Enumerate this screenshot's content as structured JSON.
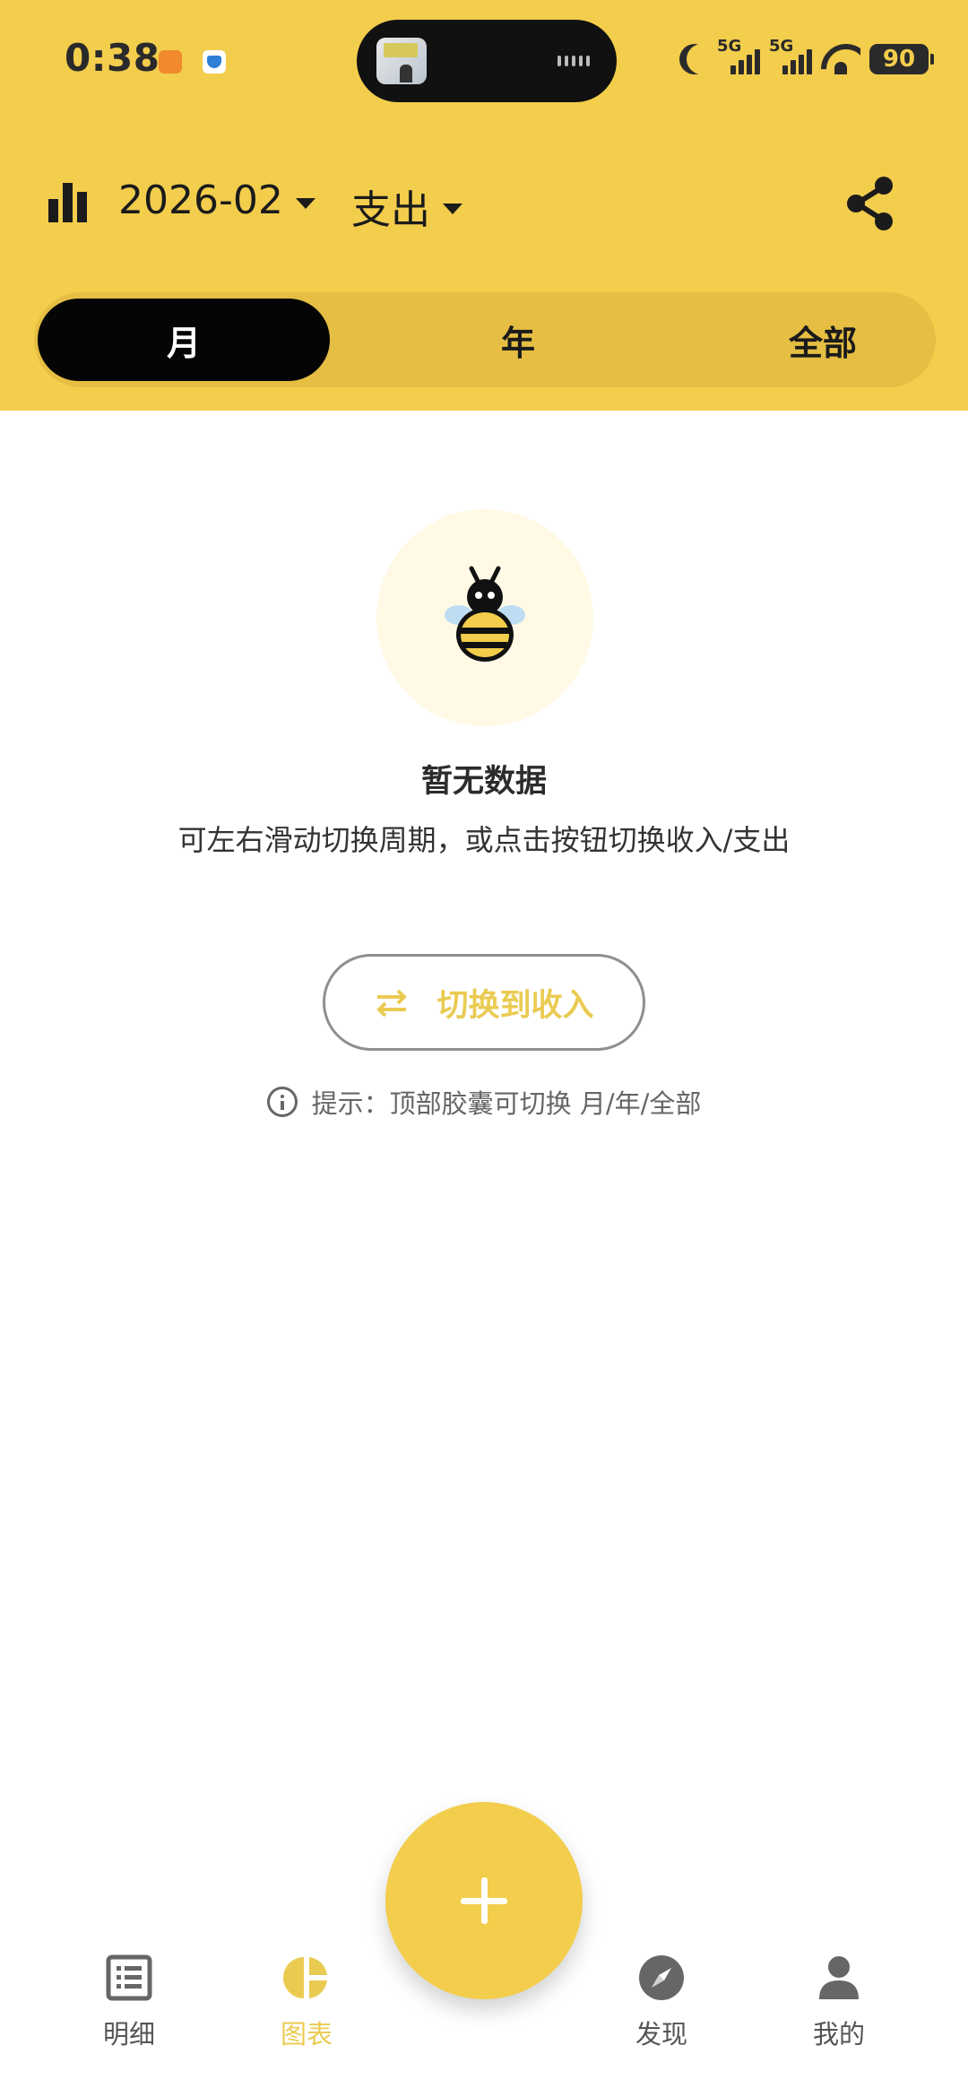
{
  "status_bar": {
    "time": "0:38",
    "network_1": "5G",
    "network_2": "5G",
    "battery": "90"
  },
  "toolbar": {
    "period": "2026-02",
    "type": "支出"
  },
  "segment_tabs": [
    {
      "label": "月",
      "active": true
    },
    {
      "label": "年",
      "active": false
    },
    {
      "label": "全部",
      "active": false
    }
  ],
  "empty_state": {
    "title": "暂无数据",
    "description": "可左右滑动切换周期，或点击按钮切换收入/支出",
    "switch_button": "切换到收入",
    "hint": "提示：顶部胶囊可切换 月/年/全部"
  },
  "bottom_nav": [
    {
      "label": "明细",
      "icon": "list-icon",
      "active": false
    },
    {
      "label": "图表",
      "icon": "pie-chart-icon",
      "active": true
    },
    {
      "label": "发现",
      "icon": "compass-icon",
      "active": false
    },
    {
      "label": "我的",
      "icon": "person-icon",
      "active": false
    }
  ],
  "colors": {
    "accent": "#F3CD4C",
    "accent_text": "#EACB52",
    "active_tab": "#050505"
  }
}
